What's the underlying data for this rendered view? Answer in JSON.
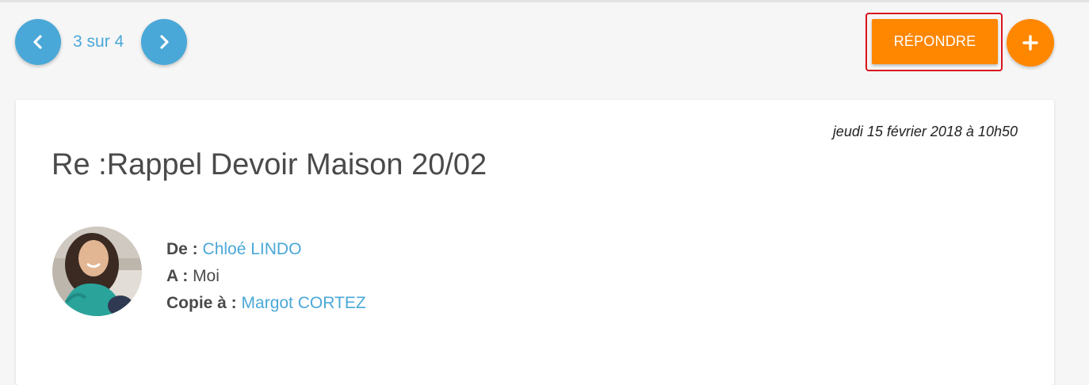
{
  "pager": {
    "current": 3,
    "total": 4,
    "label": "3 sur 4"
  },
  "actions": {
    "reply_label": "RÉPONDRE",
    "add_label": "+"
  },
  "message": {
    "date": "jeudi 15 février 2018 à 10h50",
    "subject": "Re :Rappel Devoir Maison 20/02",
    "from_label": "De :",
    "from_value": "Chloé LINDO",
    "to_label": "A :",
    "to_value": "Moi",
    "cc_label": "Copie à :",
    "cc_value": "Margot CORTEZ"
  },
  "colors": {
    "accent_blue": "#4aa8d8",
    "accent_orange": "#ff8700",
    "highlight_red": "#d9141e"
  },
  "icons": {
    "prev": "chevron-left-icon",
    "next": "chevron-right-icon",
    "add": "plus-icon"
  }
}
